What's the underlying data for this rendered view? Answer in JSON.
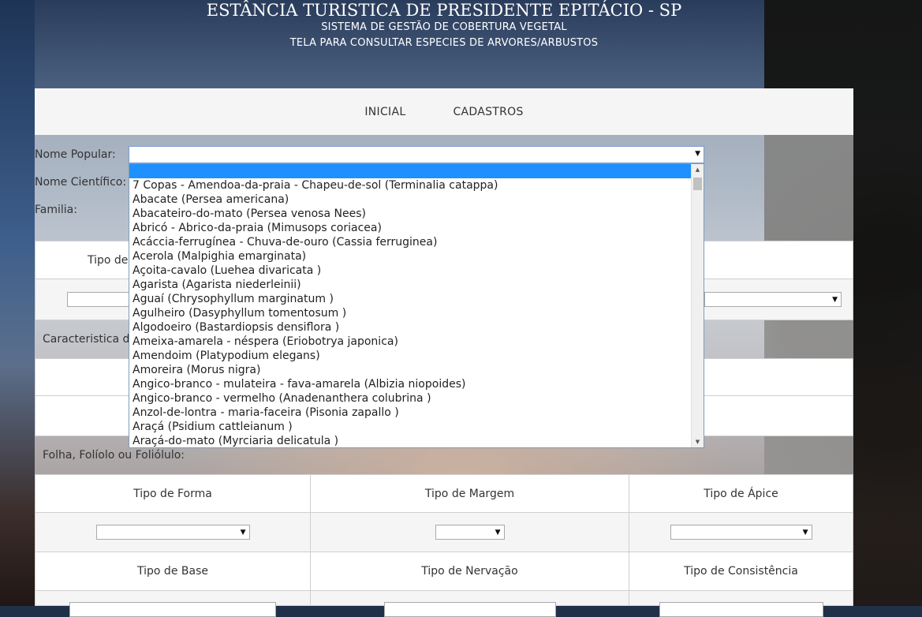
{
  "header": {
    "title": "ESTÂNCIA TURISTICA DE PRESIDENTE EPITÁCIO - SP",
    "subtitle1": "SISTEMA DE GESTÃO DE COBERTURA VEGETAL",
    "subtitle2": "TELA PARA CONSULTAR ESPECIES DE ARVORES/ARBUSTOS"
  },
  "nav": {
    "items": [
      "INICIAL",
      "CADASTROS"
    ]
  },
  "form": {
    "nome_popular_label": "Nome Popular:",
    "nome_popular_value": "",
    "nome_cientifico_label": "Nome Científico:",
    "familia_label": "Familia:"
  },
  "dropdown": {
    "options": [
      "7 Copas - Amendoa-da-praia - Chapeu-de-sol (Terminalia catappa)",
      "Abacate (Persea americana)",
      "Abacateiro-do-mato (Persea venosa Nees)",
      "Abricó - Abrico-da-praia (Mimusops coriacea)",
      "Acáccia-ferrugínea - Chuva-de-ouro (Cassia ferruginea)",
      "Acerola (Malpighia emarginata)",
      "Açoita-cavalo (Luehea divaricata )",
      "Agarista (Agarista niederleinii)",
      "Aguaí (Chrysophyllum marginatum )",
      "Agulheiro (Dasyphyllum tomentosum )",
      "Algodoeiro (Bastardiopsis densiflora )",
      "Ameixa-amarela - néspera (Eriobotrya japonica)",
      "Amendoim (Platypodium elegans)",
      "Amoreira (Morus nigra)",
      "Angico-branco - mulateira - fava-amarela (Albizia niopoides)",
      "Angico-branco - vermelho (Anadenanthera colubrina )",
      "Anzol-de-lontra - maria-faceira (Pisonia zapallo )",
      "Araçá (Psidium cattleianum )",
      "Araçá-do-mato (Myrciaria delicatula )"
    ]
  },
  "partial": {
    "tipo_de": "Tipo de",
    "caracteristica": "Caracteristica d"
  },
  "folha": {
    "section_label": "Folha, Folíolo ou Foliólulo:",
    "row1": [
      "Tipo de Forma",
      "Tipo de Margem",
      "Tipo de Ápice"
    ],
    "row2": [
      "Tipo de Base",
      "Tipo de Nervação",
      "Tipo de Consistência"
    ]
  }
}
